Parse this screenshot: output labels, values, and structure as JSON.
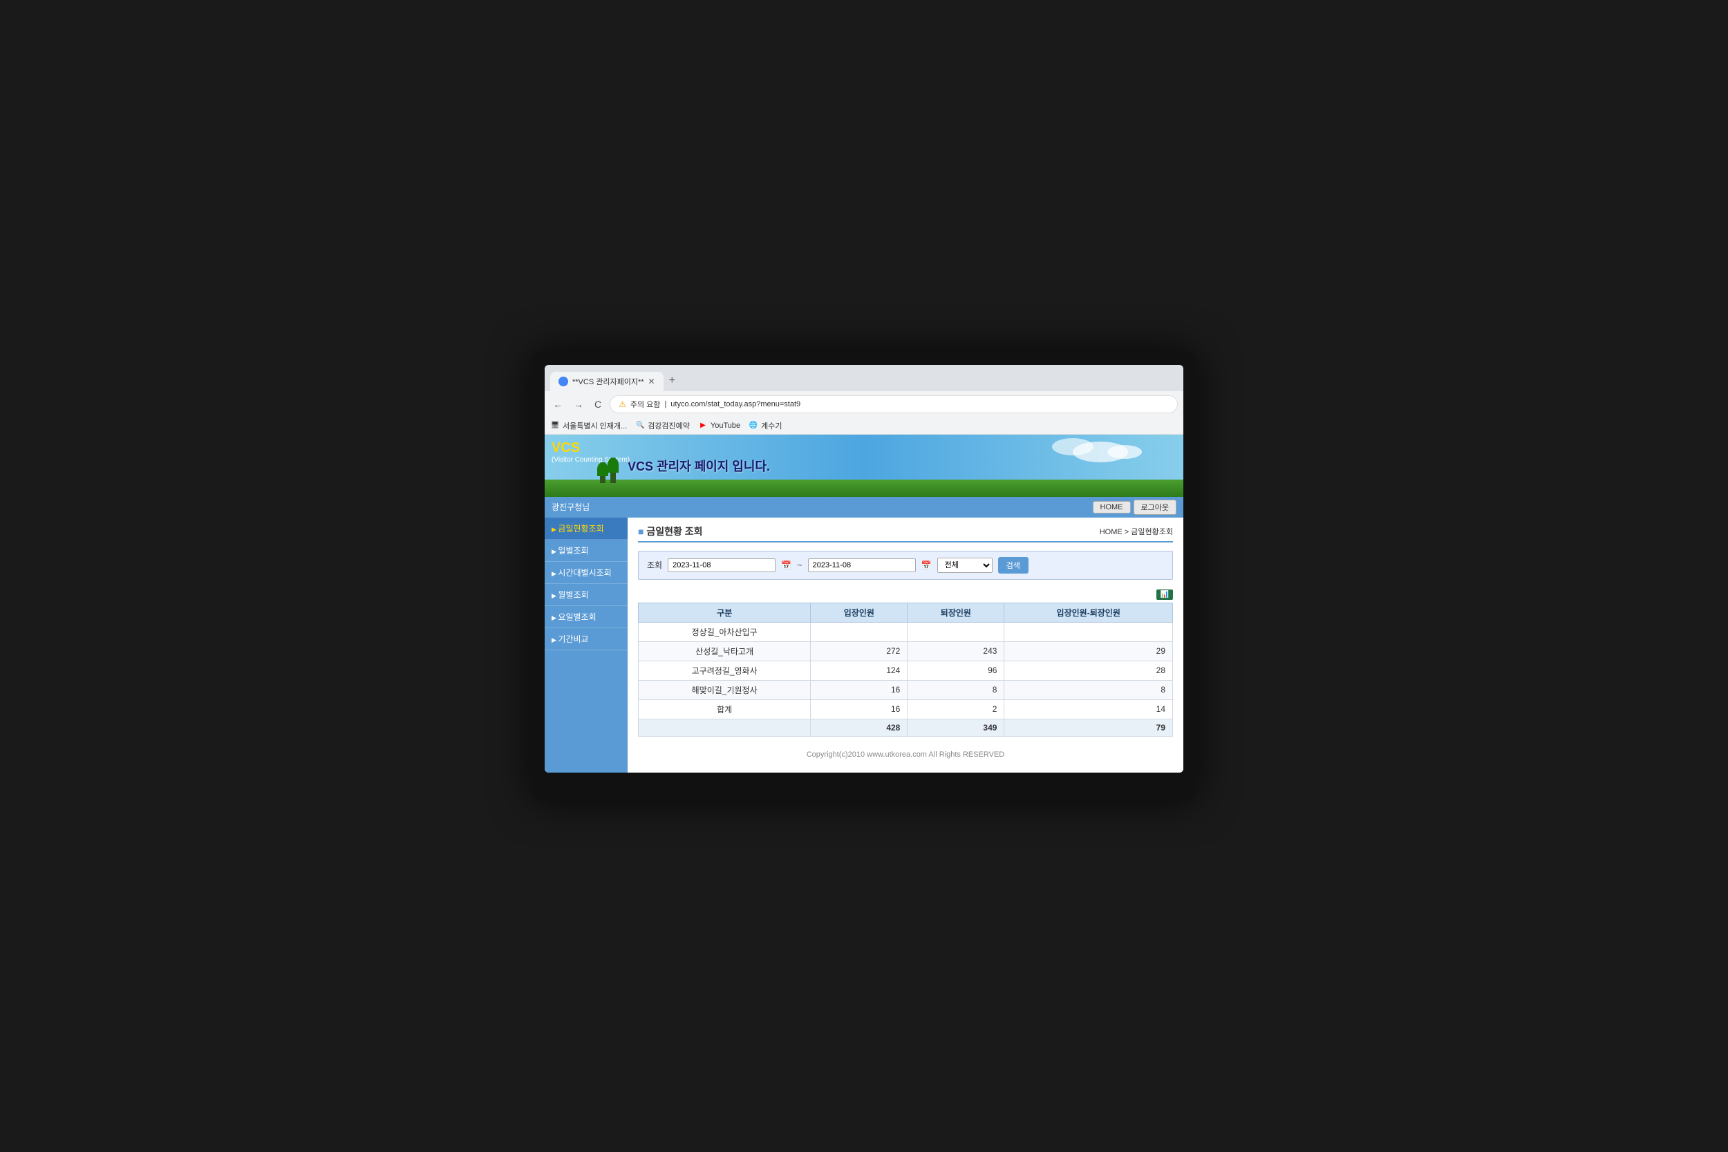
{
  "browser": {
    "tab_title": "**VCS 관리자페이지**",
    "url": "utyco.com/stat_today.asp?menu=stat9",
    "warning_text": "주의 요함",
    "new_tab_icon": "+",
    "back_icon": "←",
    "forward_icon": "→",
    "reload_icon": "C"
  },
  "bookmarks": [
    {
      "label": "서울특별시 인재개...",
      "icon": "🖥"
    },
    {
      "label": "검강검진예약",
      "icon": "🔍"
    },
    {
      "label": "YouTube",
      "icon": "▶",
      "color": "red"
    },
    {
      "label": "계수기",
      "icon": "🌐"
    }
  ],
  "vcs": {
    "logo": "VCS",
    "logo_sub": "(Visitor Counting System)",
    "banner": "VCS 관리자 페이지 입니다.",
    "greeting": "광진구청님",
    "nav_home": "HOME",
    "nav_logout": "로그아웃"
  },
  "sidebar": {
    "items": [
      {
        "label": "금일현황조회",
        "active": true
      },
      {
        "label": "일별조회"
      },
      {
        "label": "시간대별시조회"
      },
      {
        "label": "월별조회"
      },
      {
        "label": "요일별조회"
      },
      {
        "label": "기간비교"
      }
    ]
  },
  "page": {
    "title": "금일현황 조회",
    "breadcrumb": "HOME > 금일현황조회",
    "search_label": "조회",
    "date_from": "2023-11-08",
    "date_to": "2023-11-08",
    "category_default": "전체",
    "search_btn": "검색"
  },
  "table": {
    "col1": "구분",
    "col2": "입장인원",
    "col3": "퇴장인원",
    "col4": "입장인원-퇴장인원",
    "rows": [
      {
        "name": "정상길_아차산입구",
        "entry": "",
        "exit": "",
        "diff": ""
      },
      {
        "name": "산성길_낙타고개",
        "entry": "272",
        "exit": "243",
        "diff": "29"
      },
      {
        "name": "고구려정길_영화사",
        "entry": "124",
        "exit": "96",
        "diff": "28"
      },
      {
        "name": "해맞이길_기원정사",
        "entry": "16",
        "exit": "8",
        "diff": "8"
      },
      {
        "name": "합계",
        "entry": "16",
        "exit": "2",
        "diff": "14",
        "is_total": false
      },
      {
        "name": "",
        "entry": "428",
        "exit": "349",
        "diff": "79",
        "is_total": true
      }
    ]
  },
  "copyright": "Copyright(c)2010 www.utkorea.com All Rights RESERVED"
}
